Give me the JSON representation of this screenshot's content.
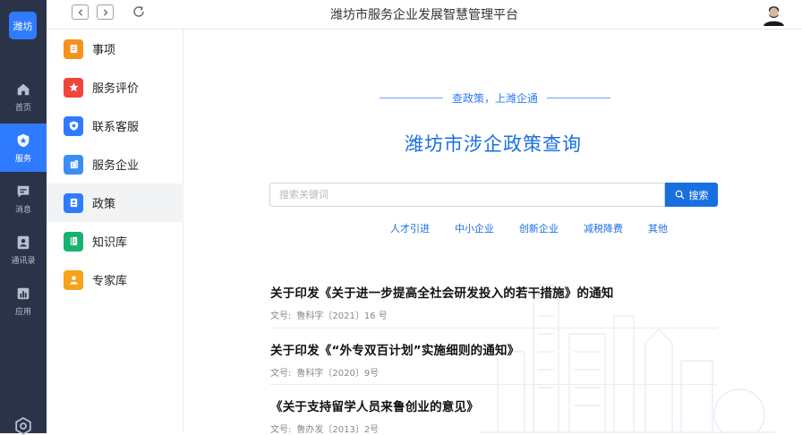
{
  "rail": {
    "logo": "潍坊",
    "items": [
      {
        "label": "首页",
        "icon": "home-icon"
      },
      {
        "label": "服务",
        "icon": "shield-star-icon",
        "active": true
      },
      {
        "label": "消息",
        "icon": "chat-icon"
      },
      {
        "label": "通讯录",
        "icon": "contacts-icon"
      },
      {
        "label": "应用",
        "icon": "apps-chart-icon"
      }
    ],
    "settings_icon": "settings-icon"
  },
  "topbar": {
    "title": "潍坊市服务企业发展智慧管理平台",
    "back_icon": "chevron-left-icon",
    "forward_icon": "chevron-right-icon",
    "refresh_icon": "refresh-icon"
  },
  "sidebar": {
    "items": [
      {
        "label": "事项",
        "icon": "document-icon",
        "color": "#f5921e"
      },
      {
        "label": "服务评价",
        "icon": "star-icon",
        "color": "#f0463a"
      },
      {
        "label": "联系客服",
        "icon": "headset-icon",
        "color": "#2f7bff"
      },
      {
        "label": "服务企业",
        "icon": "building-icon",
        "color": "#3b8cf5"
      },
      {
        "label": "政策",
        "icon": "policy-icon",
        "color": "#2f7bff",
        "active": true
      },
      {
        "label": "知识库",
        "icon": "book-icon",
        "color": "#16b36e"
      },
      {
        "label": "专家库",
        "icon": "expert-icon",
        "color": "#f7a21b"
      }
    ]
  },
  "main": {
    "slogan": "查政策，上潍企通",
    "headline": "潍坊市涉企政策查询",
    "search": {
      "placeholder": "搜索关键词",
      "value": "",
      "button_label": "搜索"
    },
    "tags": [
      "人才引进",
      "中小企业",
      "创新企业",
      "减税降费",
      "其他"
    ],
    "documents": [
      {
        "title": "关于印发《关于进一步提高全社会研发投入的若干措施》的通知",
        "meta_label": "文号:",
        "meta_value": "鲁科字〔2021〕16 号"
      },
      {
        "title": "关于印发《“外专双百计划”实施细则的通知》",
        "meta_label": "文号:",
        "meta_value": "鲁科字〔2020〕9号"
      },
      {
        "title": "《关于支持留学人员来鲁创业的意见》",
        "meta_label": "文号:",
        "meta_value": "鲁办发〔2013〕2号"
      }
    ]
  },
  "colors": {
    "rail_bg": "#2b3348",
    "accent": "#2f7bff",
    "headline": "#1a6fe0"
  }
}
